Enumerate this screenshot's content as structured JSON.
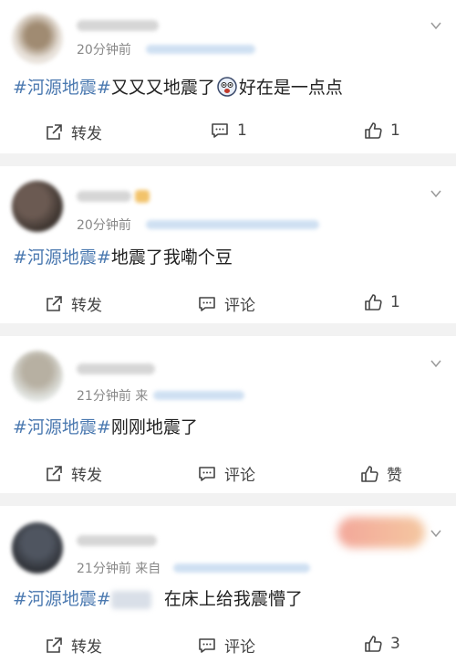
{
  "posts": [
    {
      "time": "20分钟前",
      "hashtag": "#河源地震#",
      "text_a": "又又又地震了",
      "emoji": "scared-face-icon",
      "text_b": "好在是一点点",
      "actions": {
        "repost": "转发",
        "comment": "1",
        "like": "1"
      }
    },
    {
      "time": "20分钟前",
      "hashtag": "#河源地震#",
      "text_a": "地震了我嘞个豆",
      "actions": {
        "repost": "转发",
        "comment": "评论",
        "like": "1"
      }
    },
    {
      "time": "21分钟前",
      "time_suffix": "来",
      "hashtag": "#河源地震#",
      "text_a": "刚刚地震了",
      "actions": {
        "repost": "转发",
        "comment": "评论",
        "like": "赞"
      }
    },
    {
      "time": "21分钟前",
      "time_suffix": "来自",
      "hashtag": "#河源地震#",
      "text_a": "在床上给我震懵了",
      "actions": {
        "repost": "转发",
        "comment": "评论",
        "like": "3"
      }
    }
  ],
  "colors": {
    "hashtag": "#4b79b0",
    "background": "#f2f2f2",
    "card": "#ffffff",
    "secondary_text": "#888888"
  }
}
